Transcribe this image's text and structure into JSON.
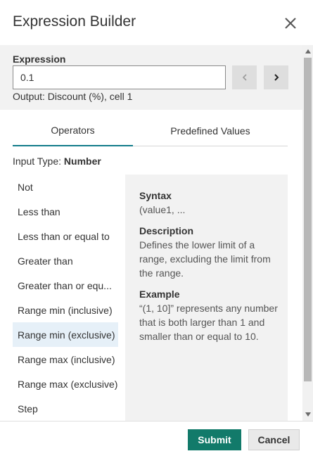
{
  "dialog": {
    "title": "Expression Builder"
  },
  "expression": {
    "label": "Expression",
    "value": "0.1",
    "output": "Output: Discount (%), cell 1"
  },
  "tabs": [
    {
      "label": "Operators",
      "active": true
    },
    {
      "label": "Predefined Values",
      "active": false
    }
  ],
  "input_type": {
    "label": "Input Type:",
    "value": "Number"
  },
  "operators": [
    {
      "label": "Not"
    },
    {
      "label": "Less than"
    },
    {
      "label": "Less than or equal to"
    },
    {
      "label": "Greater than"
    },
    {
      "label": "Greater than or equ..."
    },
    {
      "label": "Range min (inclusive)"
    },
    {
      "label": "Range min (exclusive)",
      "selected": true
    },
    {
      "label": "Range max (inclusive)"
    },
    {
      "label": "Range max (exclusive)"
    },
    {
      "label": "Step"
    }
  ],
  "details": {
    "syntax_heading": "Syntax",
    "syntax_text": "(value1, ...",
    "description_heading": "Description",
    "description_text": "Defines the lower limit of a range, excluding the limit from the range.",
    "example_heading": "Example",
    "example_text": "“(1, 10]” represents any number that is both larger than 1 and smaller than or equal to 10."
  },
  "footer": {
    "submit_label": "Submit",
    "cancel_label": "Cancel"
  },
  "colors": {
    "accent": "#127c8a",
    "submit_bg": "#127a6a",
    "selected_row": "#e6f0f8",
    "panel_bg": "#f2f2f2"
  },
  "icons": {
    "close": "close-icon",
    "prev": "chevron-left-icon",
    "next": "chevron-right-icon",
    "scroll_up": "scroll-up-arrow-icon",
    "scroll_down": "scroll-down-arrow-icon"
  }
}
